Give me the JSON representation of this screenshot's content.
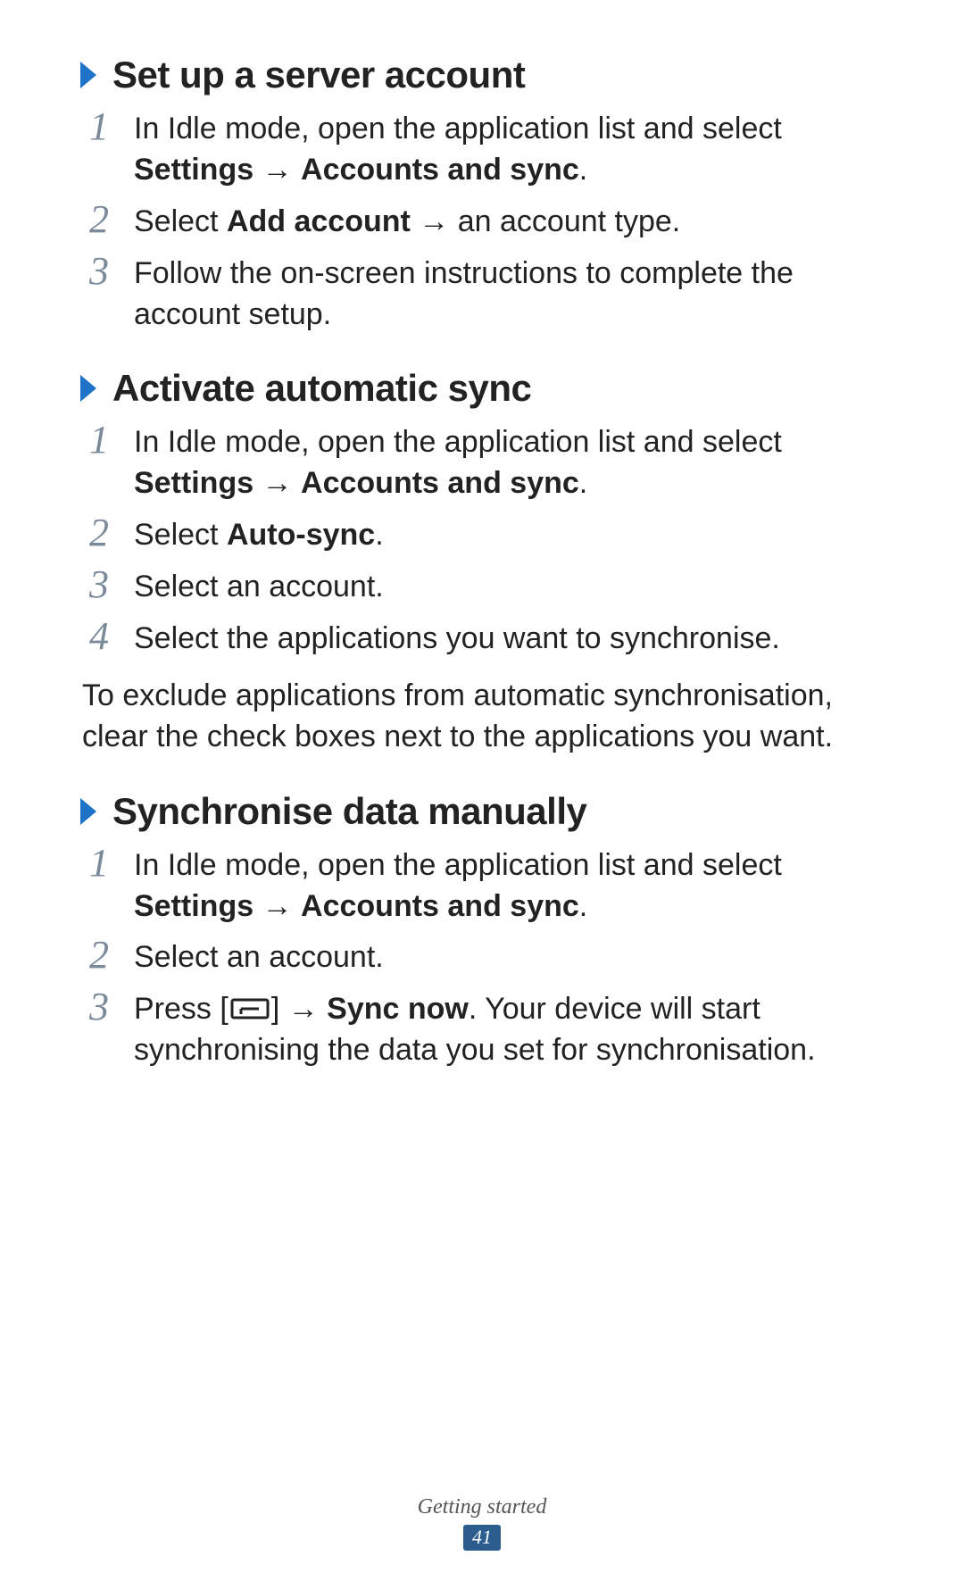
{
  "sections": [
    {
      "title": "Set up a server account",
      "steps": [
        {
          "num": "1",
          "html": "In Idle mode, open the application list and select <b>Settings</b> → <b>Accounts and sync</b>."
        },
        {
          "num": "2",
          "html": "Select <b>Add account</b> → an account type."
        },
        {
          "num": "3",
          "html": "Follow the on-screen instructions to complete the account setup."
        }
      ]
    },
    {
      "title": "Activate automatic sync",
      "steps": [
        {
          "num": "1",
          "html": "In Idle mode, open the application list and select <b>Settings</b> → <b>Accounts and sync</b>."
        },
        {
          "num": "2",
          "html": "Select <b>Auto-sync</b>."
        },
        {
          "num": "3",
          "html": "Select an account."
        },
        {
          "num": "4",
          "html": "Select the applications you want to synchronise."
        }
      ],
      "note": "To exclude applications from automatic synchronisation, clear the check boxes next to the applications you want."
    },
    {
      "title": "Synchronise data manually",
      "steps": [
        {
          "num": "1",
          "html": "In Idle mode, open the application list and select <b>Settings</b> → <b>Accounts and sync</b>."
        },
        {
          "num": "2",
          "html": "Select an account."
        },
        {
          "num": "3",
          "html": "Press [__MENUKEY__] → <b>Sync now</b>. Your device will start synchronising the data you set for synchronisation."
        }
      ]
    }
  ],
  "footer": {
    "section_label": "Getting started",
    "page_number": "41"
  },
  "icons": {
    "chevron_name": "chevron-right-icon",
    "menu_key_name": "menu-key-icon"
  }
}
